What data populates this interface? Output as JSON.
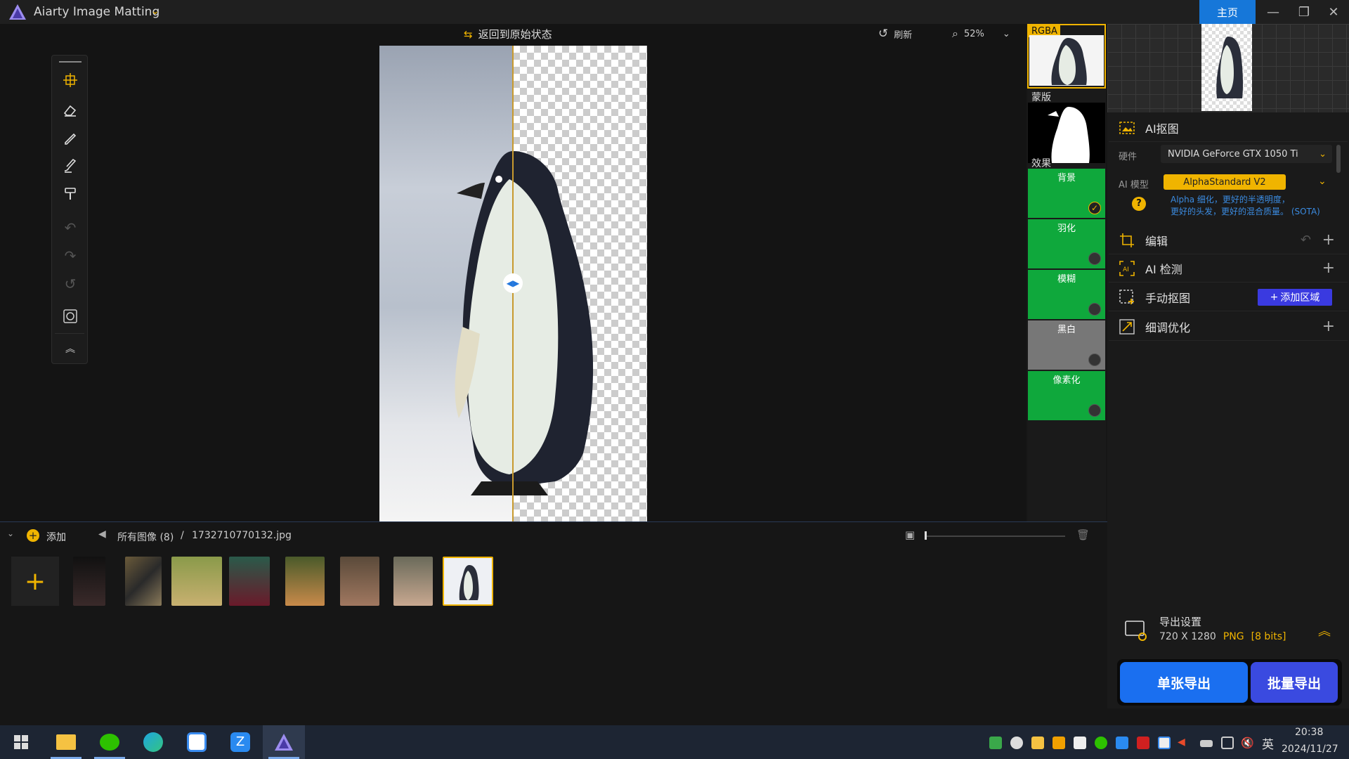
{
  "app": {
    "title": "Aiarty Image Matting",
    "home": "主页"
  },
  "canvas": {
    "restore_label": "返回到原始状态",
    "refresh_label": "刷新",
    "zoom": "52%"
  },
  "preview": {
    "rgba": "RGBA",
    "mask": "蒙版",
    "effects_label": "效果",
    "effects": [
      {
        "label": "背景",
        "selected": true
      },
      {
        "label": "羽化",
        "selected": false
      },
      {
        "label": "模糊",
        "selected": false
      },
      {
        "label": "黑白",
        "selected": false
      },
      {
        "label": "像素化",
        "selected": false
      }
    ]
  },
  "panel": {
    "ai_matting": "AI抠图",
    "hardware_label": "硬件",
    "hardware_value": "NVIDIA GeForce GTX 1050 Ti",
    "model_label": "AI 模型",
    "model_value": "AlphaStandard  V2",
    "model_desc1": "Alpha 细化，更好的半透明度，",
    "model_desc2": "更好的头发，更好的混合质量。 (SOTA)",
    "edit": "编辑",
    "ai_detect": "AI 检测",
    "manual": "手动抠图",
    "add_region": "添加区域",
    "refine": "细调优化"
  },
  "export": {
    "title": "导出设置",
    "size": "720 X 1280",
    "format": "PNG",
    "bits": "[8 bits]",
    "single": "单张导出",
    "batch": "批量导出"
  },
  "bottom": {
    "add": "添加",
    "all_images": "所有图像 (8)",
    "sep": "/",
    "filename": "1732710770132.jpg"
  },
  "clock": {
    "time": "20:38",
    "date": "2024/11/27"
  },
  "tray": {
    "lang": "英"
  },
  "colors": {
    "accent": "#1677d9",
    "gold": "#f0b400",
    "green": "#0fa83c",
    "export_blue": "#1a6ff0",
    "batch_blue": "#3a4ae0"
  }
}
